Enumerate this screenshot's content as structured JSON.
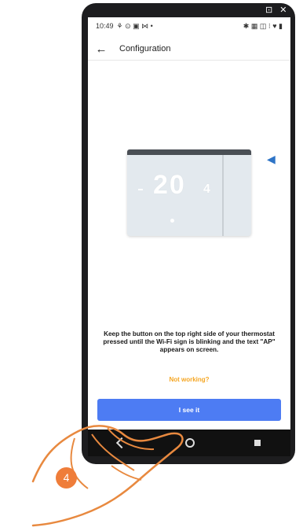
{
  "status_bar": {
    "time": "10:49",
    "left_icons": "⚘ ⊙ ▣ ⋈ •",
    "right_icons": "✱ ▦ ◫ ⁝ ♥ ▮"
  },
  "corner_icons": "⊡ ✕",
  "app_bar": {
    "back_icon": "back-arrow-icon",
    "title": "Configuration"
  },
  "thermostat": {
    "temperature": "20",
    "decimal": "4",
    "pointer_icon": "arrow-left-icon"
  },
  "instruction": "Keep the button on the top right side of your thermostat pressed until the Wi-Fi sign is blinking and the text \"AP\" appears on screen.",
  "links": {
    "not_working": "Not working?"
  },
  "buttons": {
    "primary": "I see it"
  },
  "step_badge": "4",
  "colors": {
    "primary": "#4d7cf3",
    "link": "#f5a623",
    "arrow": "#2e74c7",
    "badge": "#ef7d3a"
  }
}
